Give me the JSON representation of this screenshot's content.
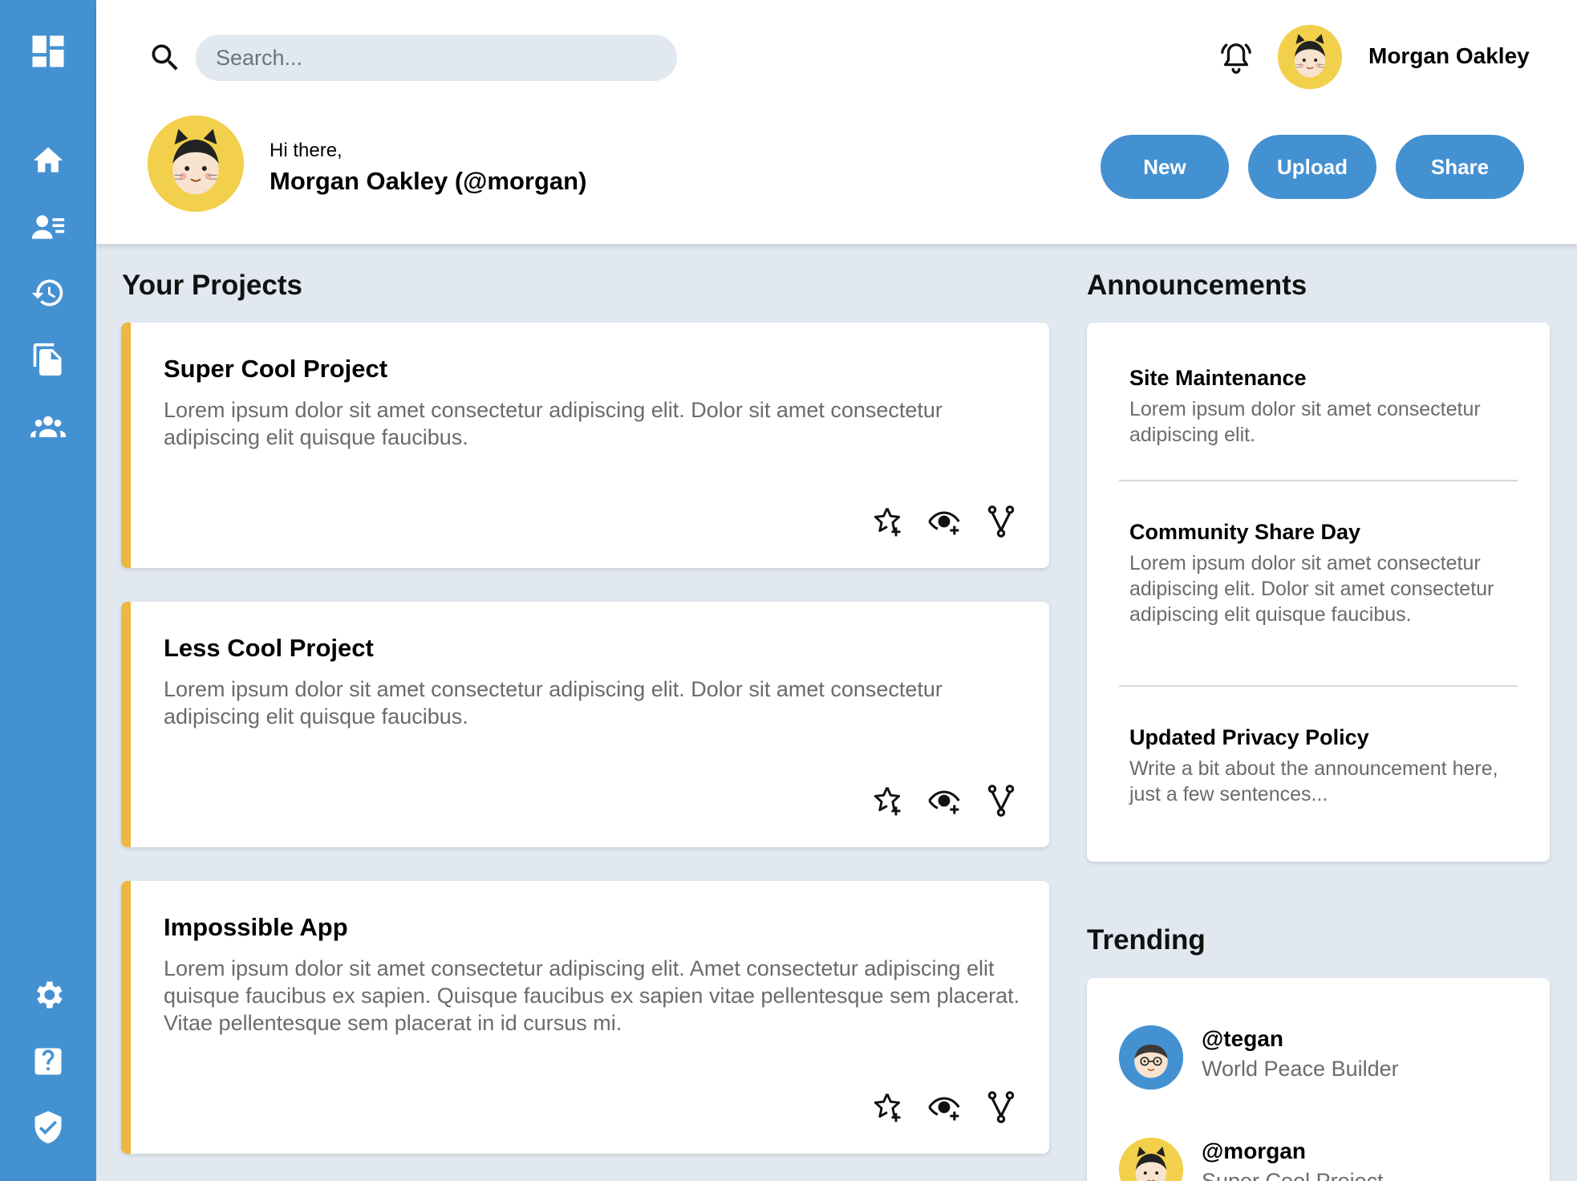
{
  "search": {
    "placeholder": "Search..."
  },
  "user": {
    "display_name": "Morgan Oakley",
    "greeting": "Hi there,",
    "full_name": "Morgan Oakley (@morgan)"
  },
  "actions": {
    "new_label": "New",
    "upload_label": "Upload",
    "share_label": "Share"
  },
  "sidebar": {
    "top_items": [
      "home-icon",
      "user-list-icon",
      "history-icon",
      "documents-icon",
      "team-icon"
    ],
    "bottom_items": [
      "settings-icon",
      "help-icon",
      "security-icon"
    ]
  },
  "projects": {
    "heading": "Your Projects",
    "items": [
      {
        "title": "Super Cool Project",
        "description": "Lorem ipsum dolor sit amet consectetur adipiscing elit. Dolor sit amet consectetur adipiscing elit quisque faucibus."
      },
      {
        "title": "Less Cool Project",
        "description": "Lorem ipsum dolor sit amet consectetur adipiscing elit. Dolor sit amet consectetur adipiscing elit quisque faucibus."
      },
      {
        "title": "Impossible App",
        "description": "Lorem ipsum dolor sit amet consectetur adipiscing elit. Amet consectetur adipiscing elit quisque faucibus ex sapien. Quisque faucibus ex sapien vitae pellentesque sem placerat. Vitae pellentesque sem placerat in id cursus mi."
      }
    ],
    "actions": [
      "star-add-icon",
      "watch-icon",
      "fork-icon"
    ]
  },
  "announcements": {
    "heading": "Announcements",
    "items": [
      {
        "title": "Site Maintenance",
        "body": "Lorem ipsum dolor sit amet consectetur adipiscing elit."
      },
      {
        "title": "Community Share Day",
        "body": "Lorem ipsum dolor sit amet consectetur adipiscing elit. Dolor sit amet consectetur adipiscing elit quisque faucibus."
      },
      {
        "title": "Updated Privacy Policy",
        "body": "Write a bit about the announcement here, just a few sentences..."
      }
    ]
  },
  "trending": {
    "heading": "Trending",
    "items": [
      {
        "handle": "@tegan",
        "subtitle": "World Peace Builder"
      },
      {
        "handle": "@morgan",
        "subtitle": "Super Cool Project"
      }
    ]
  },
  "colors": {
    "sidebar": "#4491d2",
    "accent": "#ecb842",
    "background": "#e2e8f0",
    "avatar_yellow": "#f3d04b",
    "avatar_blue": "#4491d2"
  }
}
